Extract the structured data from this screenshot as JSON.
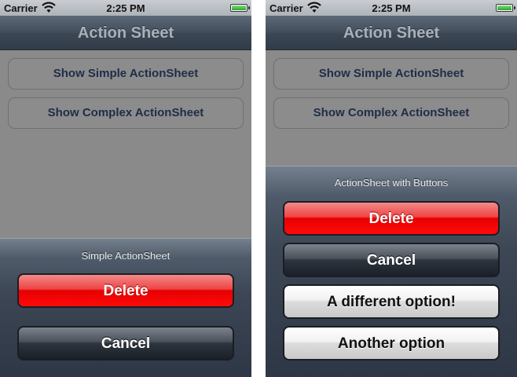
{
  "status_bar": {
    "carrier": "Carrier",
    "time": "2:25 PM"
  },
  "nav": {
    "title": "Action Sheet"
  },
  "main": {
    "simple_button_label": "Show Simple ActionSheet",
    "complex_button_label": "Show Complex ActionSheet"
  },
  "simple_sheet": {
    "title": "Simple ActionSheet",
    "buttons": [
      "Delete",
      "Cancel"
    ]
  },
  "complex_sheet": {
    "title": "ActionSheet with Buttons",
    "buttons": [
      "Delete",
      "Cancel",
      "A different option!",
      "Another option"
    ]
  },
  "icons": [
    "wifi-icon",
    "battery-icon"
  ],
  "colors": {
    "destructive": "#e60000",
    "nav_bar": "#434e5c",
    "button_text": "#1f2d47"
  }
}
